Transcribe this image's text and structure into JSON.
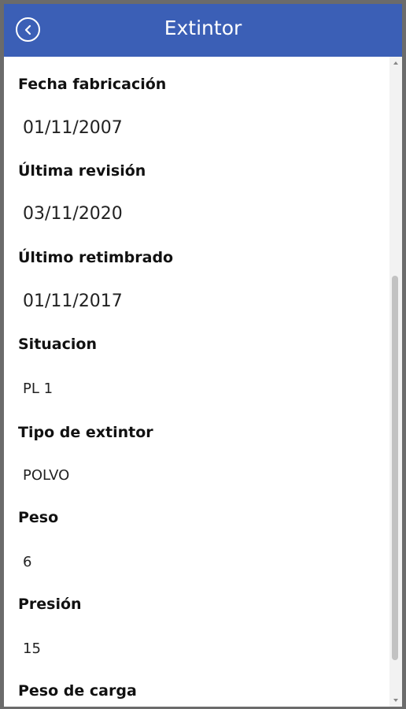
{
  "header": {
    "title": "Extintor"
  },
  "fields": [
    {
      "label": "Fecha fabricación",
      "value": "01/11/2007"
    },
    {
      "label": "Última revisión",
      "value": "03/11/2020"
    },
    {
      "label": "Último retimbrado",
      "value": "01/11/2017"
    },
    {
      "label": "Situacion",
      "value": "PL 1"
    },
    {
      "label": "Tipo de extintor",
      "value": "POLVO"
    },
    {
      "label": "Peso",
      "value": "6"
    },
    {
      "label": "Presión",
      "value": "15"
    },
    {
      "label": "Peso de carga",
      "value": ""
    }
  ],
  "colors": {
    "header_bg": "#3b5fb6",
    "header_text": "#ffffff"
  }
}
